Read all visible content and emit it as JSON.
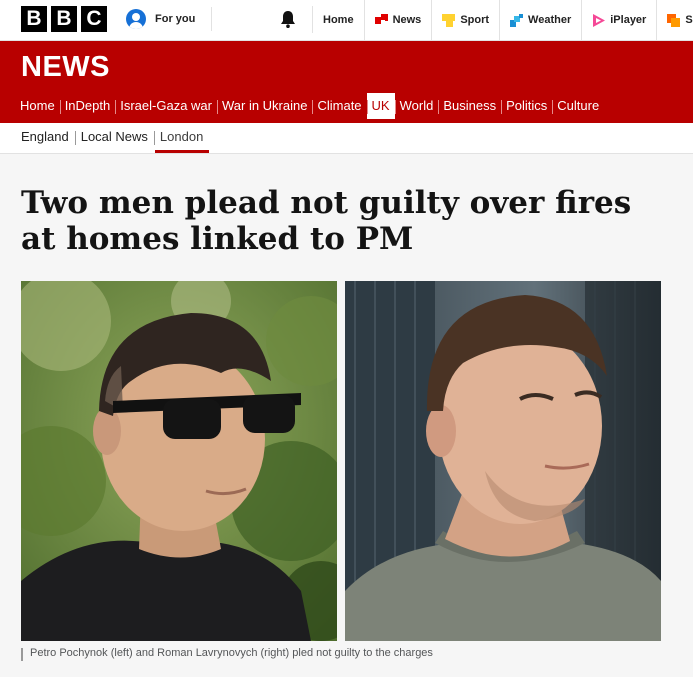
{
  "logo": {
    "letters": [
      "B",
      "B",
      "C"
    ]
  },
  "account": {
    "label": "For you",
    "icon": "user-avatar-icon"
  },
  "notifications": {
    "icon": "bell-icon"
  },
  "top_links": [
    {
      "label": "Home",
      "icon": ""
    },
    {
      "label": "News",
      "icon": "news-icon",
      "color": "#e00000"
    },
    {
      "label": "Sport",
      "icon": "sport-icon",
      "color": "#ffd230"
    },
    {
      "label": "Weather",
      "icon": "weather-icon",
      "color": "#1a8fd4"
    },
    {
      "label": "iPlayer",
      "icon": "iplayer-icon",
      "color": "#f54997"
    },
    {
      "label": "So",
      "icon": "sounds-icon",
      "color": "#ff6600"
    }
  ],
  "section_title": "NEWS",
  "nav": [
    {
      "label": "Home"
    },
    {
      "label": "InDepth"
    },
    {
      "label": "Israel-Gaza war"
    },
    {
      "label": "War in Ukraine"
    },
    {
      "label": "Climate"
    },
    {
      "label": "UK",
      "active": true
    },
    {
      "label": "World"
    },
    {
      "label": "Business"
    },
    {
      "label": "Politics"
    },
    {
      "label": "Culture"
    }
  ],
  "subnav": [
    {
      "label": "England"
    },
    {
      "label": "Local News"
    },
    {
      "label": "London",
      "active": true
    }
  ],
  "article": {
    "headline": "Two men plead not guilty over fires at homes linked to PM",
    "caption": "Petro Pochynok (left) and Roman Lavrynovych (right) pled not guilty to the charges"
  },
  "colors": {
    "brand_red": "#b80000",
    "page_bg": "#f6f6f6"
  }
}
